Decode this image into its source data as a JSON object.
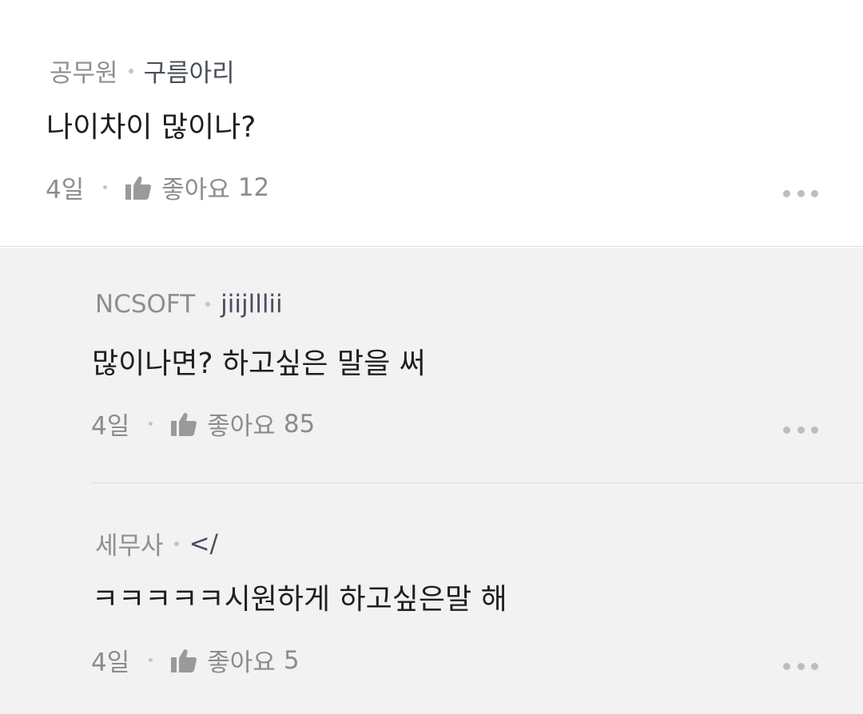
{
  "comment": {
    "job": "공무원",
    "nickname": "구름아리",
    "text": "나이차이 많이나?",
    "time": "4일",
    "like_label": "좋아요",
    "like_count": "12"
  },
  "replies": [
    {
      "job": "NCSOFT",
      "nickname": "jiijlllii",
      "text": "많이나면? 하고싶은 말을 써",
      "time": "4일",
      "like_label": "좋아요",
      "like_count": "85"
    },
    {
      "job": "세무사",
      "nickname": "</",
      "text": "ㅋㅋㅋㅋㅋ시원하게 하고싶은말 해",
      "time": "4일",
      "like_label": "좋아요",
      "like_count": "5"
    }
  ],
  "icons": {
    "like": "thumbs-up-icon",
    "more": "more-dots-icon"
  },
  "colors": {
    "reply_background": "#f2f2f2",
    "text_primary": "#1f1f1f",
    "text_secondary": "#8c8c8c",
    "nickname": "#4a4f5e"
  }
}
